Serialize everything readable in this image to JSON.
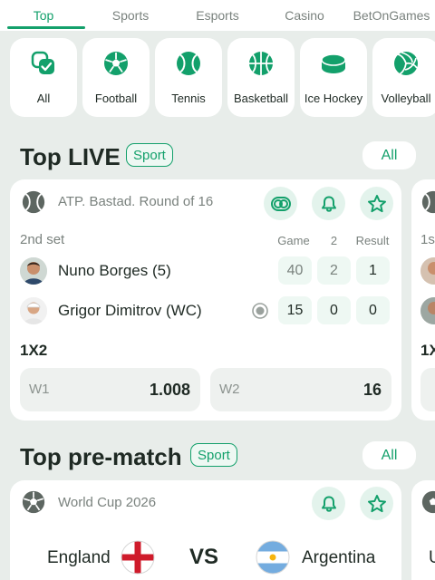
{
  "tabs": [
    {
      "label": "Top",
      "active": true
    },
    {
      "label": "Sports",
      "active": false
    },
    {
      "label": "Esports",
      "active": false
    },
    {
      "label": "Casino",
      "active": false
    },
    {
      "label": "BetOnGames",
      "active": false
    }
  ],
  "sport_tiles": [
    {
      "label": "All",
      "icon": "all-sports-icon"
    },
    {
      "label": "Football",
      "icon": "football-icon"
    },
    {
      "label": "Tennis",
      "icon": "tennis-ball-icon"
    },
    {
      "label": "Basketball",
      "icon": "basketball-icon"
    },
    {
      "label": "Ice Hockey",
      "icon": "hockey-puck-icon"
    },
    {
      "label": "Volleyball",
      "icon": "volleyball-icon"
    }
  ],
  "top_live": {
    "title": "Top LIVE",
    "badge": "Sport",
    "all_label": "All",
    "match": {
      "tournament": "ATP. Bastad. Round of 16",
      "period": "2nd set",
      "columns": [
        "Game",
        "2",
        "Result"
      ],
      "players": [
        {
          "name": "Nuno Borges (5)",
          "scores": [
            "40",
            "2",
            "1"
          ],
          "serving": false
        },
        {
          "name": "Grigor Dimitrov (WC)",
          "scores": [
            "15",
            "0",
            "0"
          ],
          "serving": true
        }
      ],
      "market": "1X2",
      "odds": [
        {
          "label": "W1",
          "value": "1.008"
        },
        {
          "label": "W2",
          "value": "16"
        }
      ]
    },
    "peek_card": {
      "period": "1s",
      "market": "1X"
    }
  },
  "top_prematch": {
    "title": "Top pre-match",
    "badge": "Sport",
    "all_label": "All",
    "match": {
      "tournament": "World Cup 2026",
      "team1": "England",
      "team2": "Argentina",
      "vs": "VS"
    },
    "peek_card": {
      "team": "U"
    }
  },
  "colors": {
    "accent": "#13a06b",
    "background": "#e8edea",
    "card": "#ffffff",
    "score_cell": "#eef8f3"
  }
}
